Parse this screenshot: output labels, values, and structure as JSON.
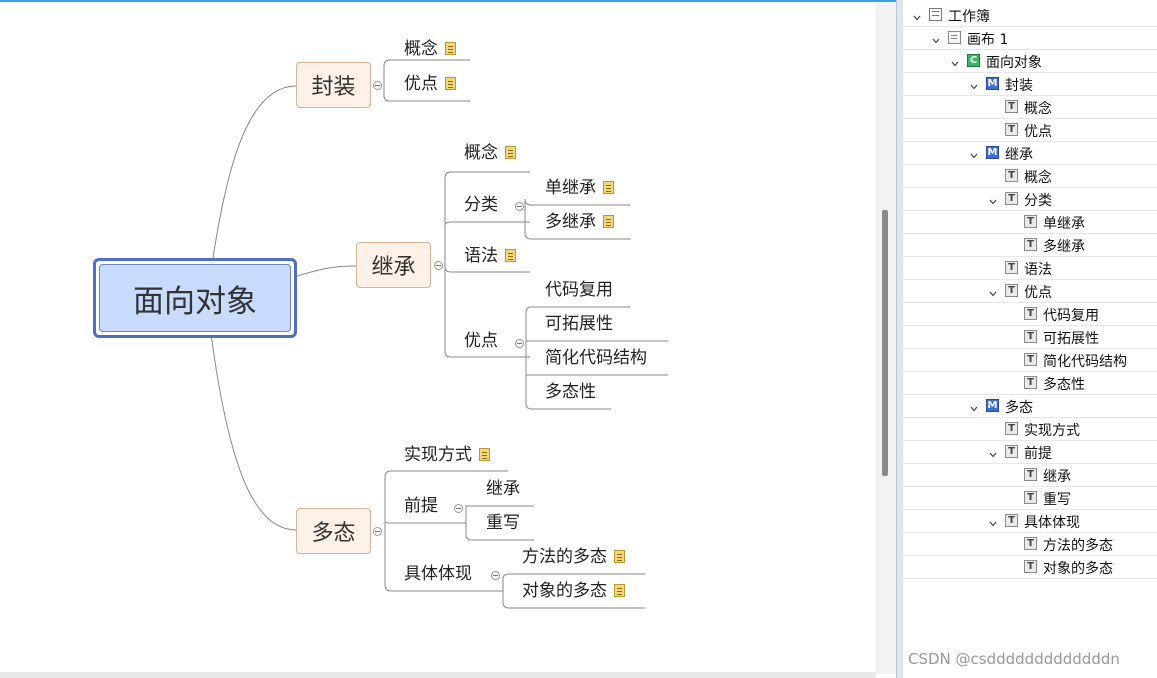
{
  "mindmap": {
    "central": "面向对象",
    "encapsulation": {
      "label": "封装",
      "c1": "概念",
      "c2": "优点"
    },
    "inheritance": {
      "label": "继承",
      "concept": "概念",
      "category": "分类",
      "single": "单继承",
      "multiple": "多继承",
      "syntax": "语法",
      "advantage": "优点",
      "reuse": "代码复用",
      "extensible": "可拓展性",
      "simplify": "简化代码结构",
      "polymorphism": "多态性"
    },
    "polymorphism": {
      "label": "多态",
      "implementation": "实现方式",
      "premise": "前提",
      "inherit": "继承",
      "override": "重写",
      "manifestation": "具体体现",
      "method": "方法的多态",
      "object": "对象的多态"
    }
  },
  "outline": {
    "workbook": "工作簿",
    "sheet": "画布 1",
    "root": "面向对象",
    "items": {
      "encap": "封装",
      "encap_concept": "概念",
      "encap_adv": "优点",
      "inherit": "继承",
      "inherit_concept": "概念",
      "inherit_cat": "分类",
      "single": "单继承",
      "multiple": "多继承",
      "syntax": "语法",
      "inherit_adv": "优点",
      "reuse": "代码复用",
      "extensible": "可拓展性",
      "simplify": "简化代码结构",
      "poly_prop": "多态性",
      "poly": "多态",
      "impl": "实现方式",
      "premise": "前提",
      "premise_inherit": "继承",
      "premise_override": "重写",
      "manifest": "具体体现",
      "method": "方法的多态",
      "object": "对象的多态"
    }
  },
  "watermark": "CSDN @csdddddddddddddn",
  "icons": {
    "workbook": "workbook-icon",
    "sheet": "sheet-icon",
    "central": "central-topic-icon",
    "main": "main-topic-icon",
    "topic": "topic-icon",
    "note": "note-icon",
    "collapse": "collapse-icon",
    "chevron": "chevron-down-icon"
  },
  "colors": {
    "central_fill": "#c9dcff",
    "central_border": "#4f70c0",
    "main_fill": "#fdf1e8",
    "accent": "#3aa0e0"
  }
}
